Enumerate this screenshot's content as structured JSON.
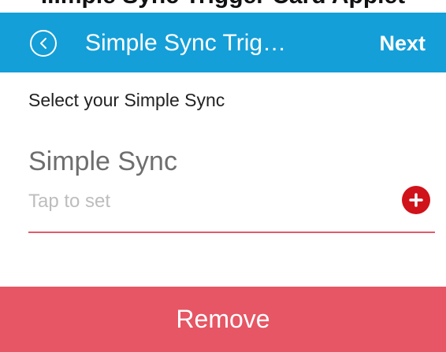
{
  "top_strip": {
    "text": "...mple Sync Trigger Card Applet"
  },
  "header": {
    "title": "Simple Sync Trig…",
    "next_label": "Next",
    "back_icon": "circle-chevron-left-icon",
    "background_color": "#149fd8"
  },
  "content": {
    "instruction": "Select your Simple Sync",
    "field": {
      "label": "Simple Sync",
      "placeholder": "Tap to set",
      "add_icon": "plus-circle-icon",
      "accent_color": "#d0121b",
      "underline_color": "#e05b68"
    }
  },
  "footer": {
    "remove_label": "Remove",
    "remove_color": "#e65664"
  }
}
